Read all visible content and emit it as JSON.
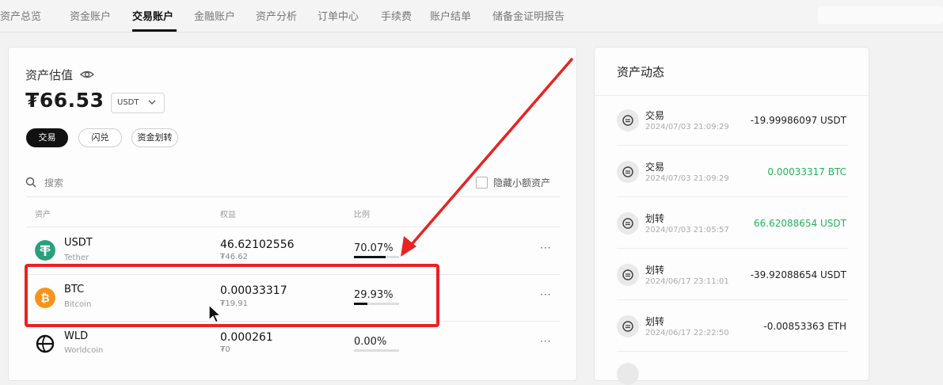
{
  "tabs": [
    "资产总览",
    "资金账户",
    "交易账户",
    "金融账户",
    "资产分析",
    "订单中心",
    "手续费",
    "账户结单",
    "储备金证明报告"
  ],
  "active_tab": "交易账户",
  "asset": {
    "title": "资产估值",
    "balance": "₮66.53",
    "currency": "USDT",
    "buttons": [
      "交易",
      "闪兑",
      "资金划转"
    ]
  },
  "search": {
    "placeholder": "搜索"
  },
  "hide_small_label": "隐藏小额资产",
  "columns": {
    "asset": "资产",
    "equity": "权益",
    "ratio": "比例"
  },
  "holdings": [
    {
      "symbol": "USDT",
      "name": "Tether",
      "amount": "46.62102556",
      "fiat": "₮46.62",
      "ratio_text": "70.07%",
      "ratio": 70.07,
      "color": "#26a17b"
    },
    {
      "symbol": "BTC",
      "name": "Bitcoin",
      "amount": "0.00033317",
      "fiat": "₮19.91",
      "ratio_text": "29.93%",
      "ratio": 29.93,
      "color": "#f7931a"
    },
    {
      "symbol": "WLD",
      "name": "Worldcoin",
      "amount": "0.000261",
      "fiat": "₮0",
      "ratio_text": "0.00%",
      "ratio": 0,
      "color": "#111111"
    }
  ],
  "activity": {
    "title": "资产动态",
    "items": [
      {
        "type": "交易",
        "time": "2024/07/03 21:09:29",
        "amount": "-19.99986097 USDT",
        "positive": false
      },
      {
        "type": "交易",
        "time": "2024/07/03 21:09:29",
        "amount": "0.00033317 BTC",
        "positive": true
      },
      {
        "type": "划转",
        "time": "2024/07/03 21:05:57",
        "amount": "66.62088654 USDT",
        "positive": true
      },
      {
        "type": "划转",
        "time": "2024/06/17 23:11:01",
        "amount": "-39.92088654 USDT",
        "positive": false
      },
      {
        "type": "划转",
        "time": "2024/06/17 22:22:50",
        "amount": "-0.00853363 ETH",
        "positive": false
      }
    ]
  },
  "colors": {
    "highlight": "#ea2222",
    "positive": "#21b35b"
  }
}
